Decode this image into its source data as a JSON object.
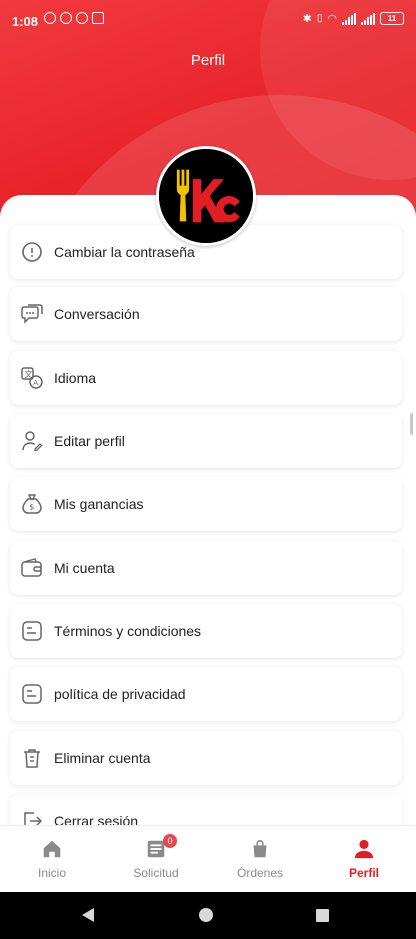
{
  "status_bar": {
    "time": "1:08",
    "battery": "11"
  },
  "header": {
    "title": "Perfil"
  },
  "colors": {
    "brand_red": "#e31d24",
    "logo_fork": "#f2c200",
    "inactive_gray": "#8a8a8a"
  },
  "logo": {
    "text": "KC"
  },
  "menu": {
    "items": [
      {
        "label": "Cambiar la contraseña",
        "icon": "lock-info-icon"
      },
      {
        "label": "Conversación",
        "icon": "chat-bubble-icon"
      },
      {
        "label": "Idioma",
        "icon": "translate-icon"
      },
      {
        "label": "Editar perfil",
        "icon": "user-edit-icon"
      },
      {
        "label": "Mis ganancias",
        "icon": "money-bag-icon"
      },
      {
        "label": "Mi cuenta",
        "icon": "wallet-icon"
      },
      {
        "label": "Términos y condiciones",
        "icon": "document-icon"
      },
      {
        "label": "política de privacidad",
        "icon": "document-icon"
      },
      {
        "label": "Eliminar cuenta",
        "icon": "trash-icon"
      },
      {
        "label": "Cerrar sesión",
        "icon": "logout-icon"
      }
    ]
  },
  "bottom_nav": {
    "items": [
      {
        "label": "Inicio",
        "icon": "home-icon"
      },
      {
        "label": "Solicitud",
        "icon": "request-icon",
        "badge": "0"
      },
      {
        "label": "Órdenes",
        "icon": "bag-icon"
      },
      {
        "label": "Perfil",
        "icon": "person-icon",
        "active": true
      }
    ]
  }
}
